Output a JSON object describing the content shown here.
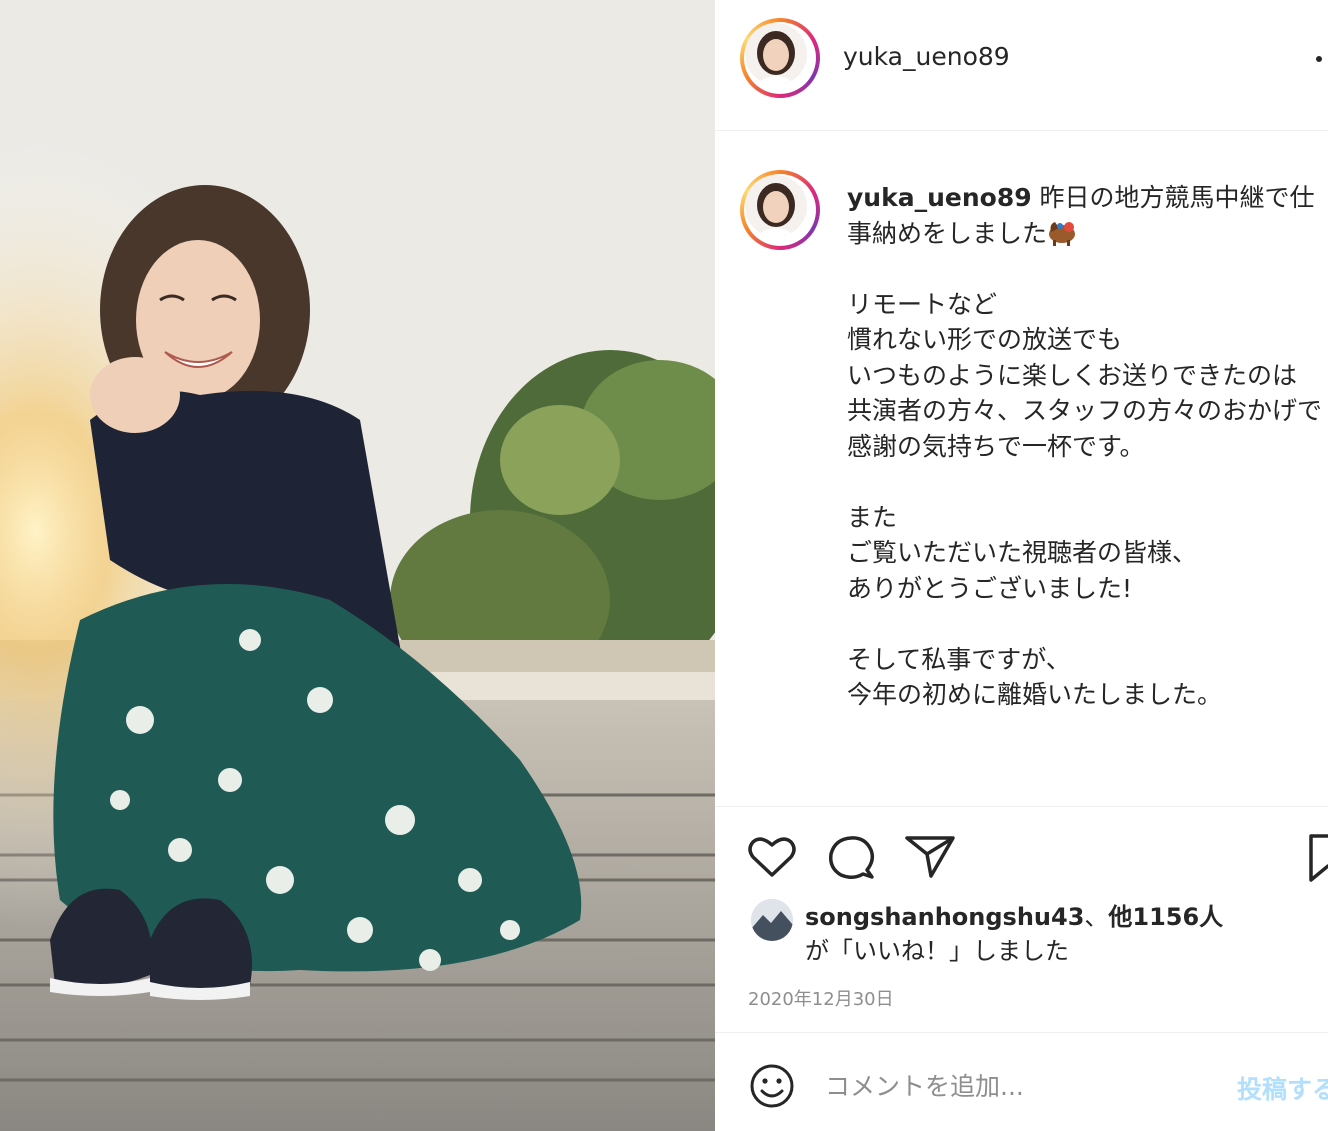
{
  "post": {
    "author": "yuka_ueno89",
    "caption_text": " 昨日の地方競馬中継で仕事納めをしました",
    "caption_emoji": "racehorse-emoji",
    "caption_body": "\n\nリモートなど\n慣れない形での放送でも\nいつものように楽しくお送りできたのは\n共演者の方々、スタッフの方々のおかげで\n感謝の気持ちで一杯です。\n\nまた\nご覧いただいた視聴者の皆様、\nありがとうございました!\n\nそして私事ですが、\n今年の初めに離婚いたしました。"
  },
  "icons": {
    "more": "more-options-icon",
    "like": "heart-icon",
    "comment": "comment-icon",
    "share": "share-icon",
    "save": "bookmark-icon",
    "emoji": "emoji-icon"
  },
  "likes": {
    "user": "songshanhongshu43",
    "separator": "、",
    "others": "他1156人",
    "suffix": "が「いいね！」しました"
  },
  "date": "2020年12月30日",
  "comment": {
    "placeholder": "コメントを追加...",
    "post_label": "投稿する"
  },
  "colors": {
    "accent_disabled": "#b2dffc",
    "text": "#262626",
    "secondary": "#8e8e8e"
  }
}
